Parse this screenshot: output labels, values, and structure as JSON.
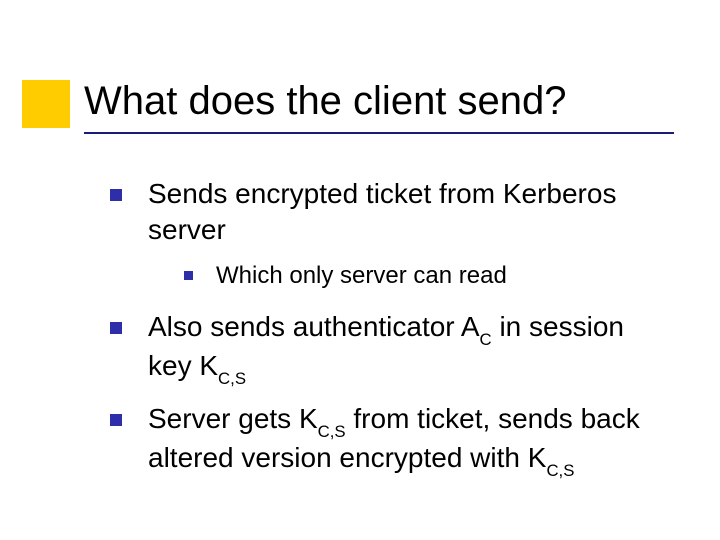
{
  "title": "What does the client send?",
  "bullets": {
    "b1": "Sends encrypted ticket from Kerberos server",
    "b1a": "Which only server can read",
    "b2_pre": "Also sends authenticator A",
    "b2_sub1": "C",
    "b2_mid": " in session key K",
    "b2_sub2": "C,S",
    "b3_pre": "Server gets K",
    "b3_sub1": "C,S",
    "b3_mid": " from ticket, sends back altered version encrypted with K",
    "b3_sub2": "C,S"
  }
}
